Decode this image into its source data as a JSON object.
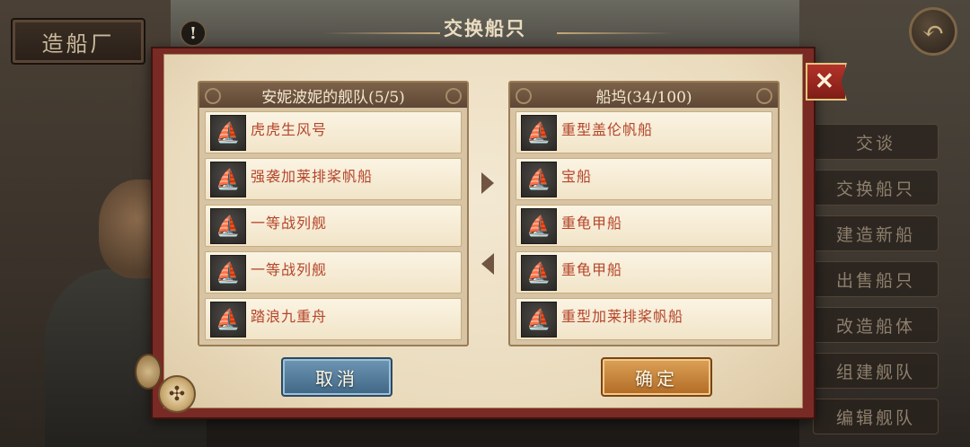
{
  "background": {
    "shipyard_sign": "造船厂",
    "alert_icon": "!",
    "back_icon": "back-arrow-icon",
    "side_menu": [
      "交谈",
      "交换船只",
      "建造新船",
      "出售船只",
      "改造船体",
      "组建舰队",
      "编辑舰队"
    ]
  },
  "dialog": {
    "title": "交换船只",
    "close_icon": "✕",
    "left_panel": {
      "title": "安妮波妮的舰队(5/5)",
      "ships": [
        {
          "name": "虎虎生风号",
          "icon": "galleon-icon"
        },
        {
          "name": "强袭加莱排桨帆船",
          "icon": "galley-icon"
        },
        {
          "name": "一等战列舰",
          "icon": "ship-of-the-line-icon"
        },
        {
          "name": "一等战列舰",
          "icon": "ship-of-the-line-icon"
        },
        {
          "name": "踏浪九重舟",
          "icon": "junk-icon"
        }
      ]
    },
    "right_panel": {
      "title": "船坞(34/100)",
      "ships": [
        {
          "name": "重型盖伦帆船",
          "icon": "galleon-icon"
        },
        {
          "name": "宝船",
          "icon": "junk-icon"
        },
        {
          "name": "重龟甲船",
          "icon": "turtle-ship-icon"
        },
        {
          "name": "重龟甲船",
          "icon": "turtle-ship-icon"
        },
        {
          "name": "重型加莱排桨帆船",
          "icon": "galley-icon"
        }
      ]
    },
    "cancel_label": "取消",
    "confirm_label": "确定"
  },
  "colors": {
    "frame": "#7a2a24",
    "parchment": "#f3e8d2",
    "ship_name": "#b4452a",
    "cancel_button": "#4f7797",
    "confirm_button": "#c8843a"
  }
}
